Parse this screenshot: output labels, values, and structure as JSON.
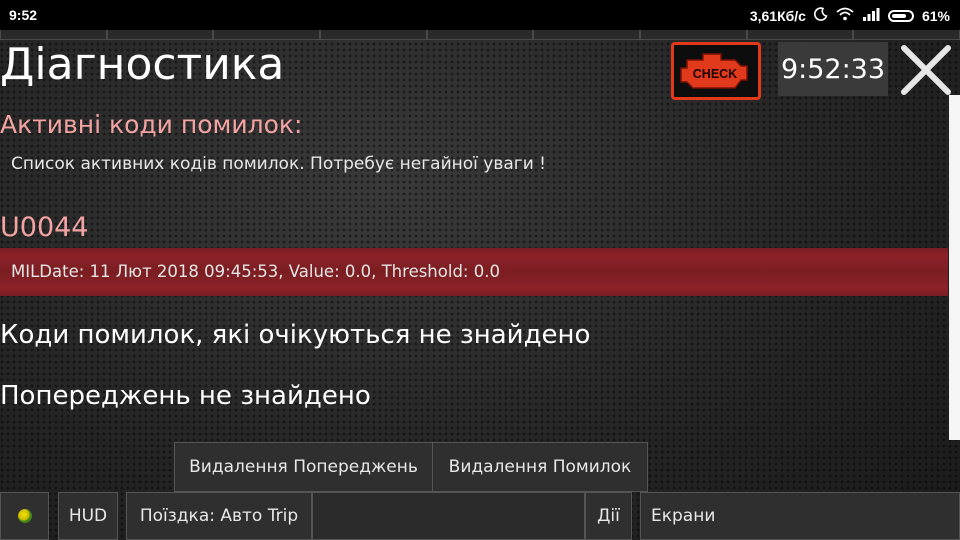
{
  "status_bar": {
    "time": "9:52",
    "network_speed": "3,61Кб/с",
    "battery_percent": "61%",
    "icons": [
      "moon-icon",
      "wifi-icon",
      "signal-icon",
      "battery-icon"
    ]
  },
  "header": {
    "title": "Діагностика",
    "check_label": "CHECK",
    "clock": "9:52:33",
    "close_icon": "close-icon"
  },
  "active_codes": {
    "title": "Активні коди помилок:",
    "description": "Список активних кодів помилок. Потребує негайної уваги !",
    "items": [
      {
        "code": "U0044",
        "detail": "MILDate: 11 Лют 2018 09:45:53, Value: 0.0, Threshold: 0.0"
      }
    ]
  },
  "pending_codes": {
    "message": "Коди помилок, які очікуються не знайдено"
  },
  "warnings": {
    "message": "Попереджень не знайдено"
  },
  "actions": {
    "delete_warnings": "Видалення Попереджень",
    "delete_errors": "Видалення Помилок"
  },
  "bottom_bar": {
    "hud": "HUD",
    "trip": "Поїздка: Авто Trip",
    "actions": "Дії",
    "screens": "Екрани"
  },
  "colors": {
    "accent_pink": "#f4a3a3",
    "error_row": "#7a1e22",
    "check_border": "#e03a1a"
  }
}
